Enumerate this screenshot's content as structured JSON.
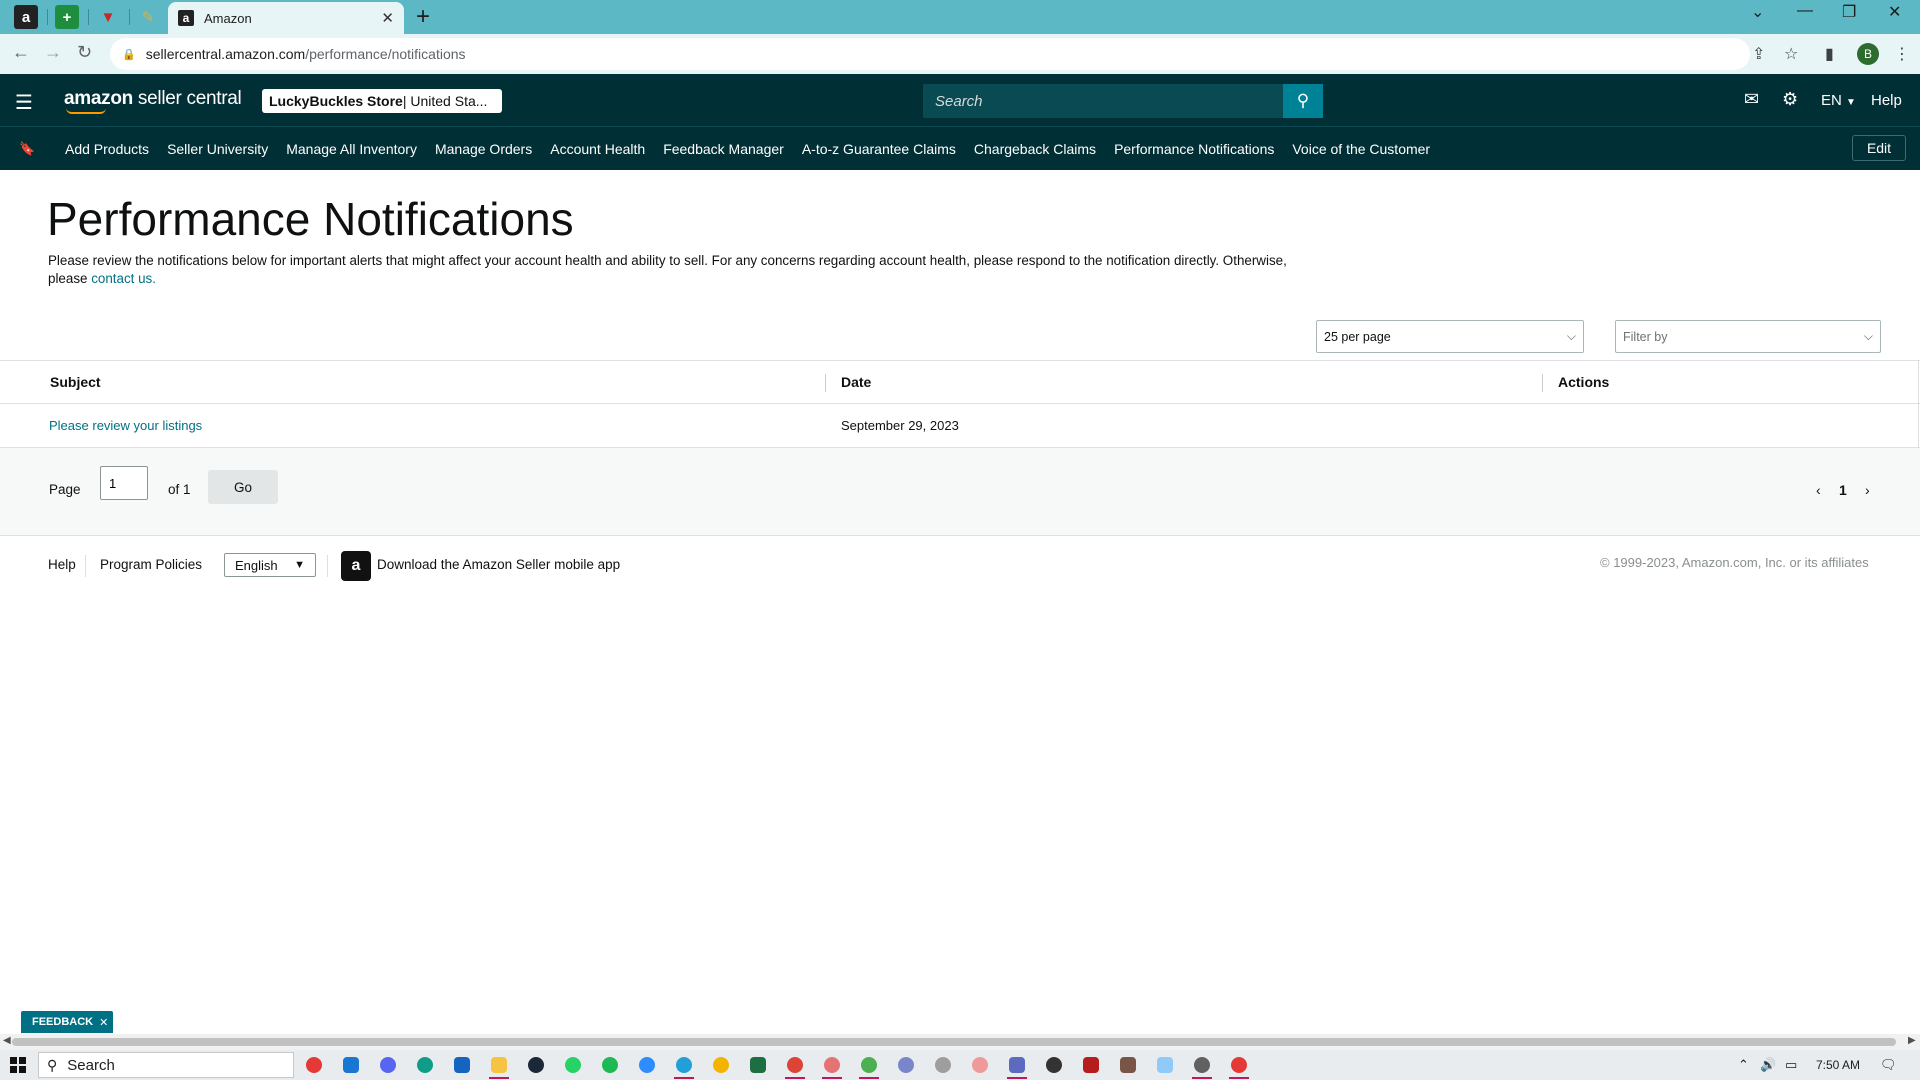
{
  "browser": {
    "active_tab_title": "Amazon",
    "active_tab_favicon": "a",
    "url_host": "sellercentral.amazon.com",
    "url_path": "/performance/notifications",
    "profile_initial": "B"
  },
  "header": {
    "logo_bold": "amazon",
    "logo_thin": " seller central",
    "store_name": "LuckyBuckles Store",
    "store_region": " | United Sta...",
    "search_placeholder": "Search",
    "language": "EN",
    "help": "Help"
  },
  "nav": {
    "links": [
      "Add Products",
      "Seller University",
      "Manage All Inventory",
      "Manage Orders",
      "Account Health",
      "Feedback Manager",
      "A-to-z Guarantee Claims",
      "Chargeback Claims",
      "Performance Notifications",
      "Voice of the Customer"
    ],
    "edit": "Edit"
  },
  "main": {
    "title": "Performance Notifications",
    "description": "Please review the notifications below for important alerts that might affect your account health and ability to sell. For any concerns regarding account health, please respond to the notification directly. Otherwise, please ",
    "contact_link": "contact us.",
    "per_page": "25 per page",
    "filter_placeholder": "Filter by"
  },
  "table": {
    "headers": {
      "subject": "Subject",
      "date": "Date",
      "actions": "Actions"
    },
    "rows": [
      {
        "subject": "Please review your listings",
        "date": "September 29, 2023",
        "actions": ""
      }
    ]
  },
  "pagination": {
    "page_label": "Page",
    "page_value": "1",
    "of_label": "of 1",
    "go": "Go",
    "current": "1"
  },
  "footer": {
    "help": "Help",
    "program_policies": "Program Policies",
    "language": "English",
    "app_text": "Download the Amazon Seller mobile app",
    "copyright": "© 1999-2023, Amazon.com, Inc. or its affiliates"
  },
  "feedback": "FEEDBACK",
  "taskbar": {
    "search": "Search",
    "time": "7:50 AM"
  },
  "colors": {
    "tabbar": "#5bb8c4",
    "header_bg": "#002f36",
    "link": "#007185",
    "search_button": "#008296"
  }
}
